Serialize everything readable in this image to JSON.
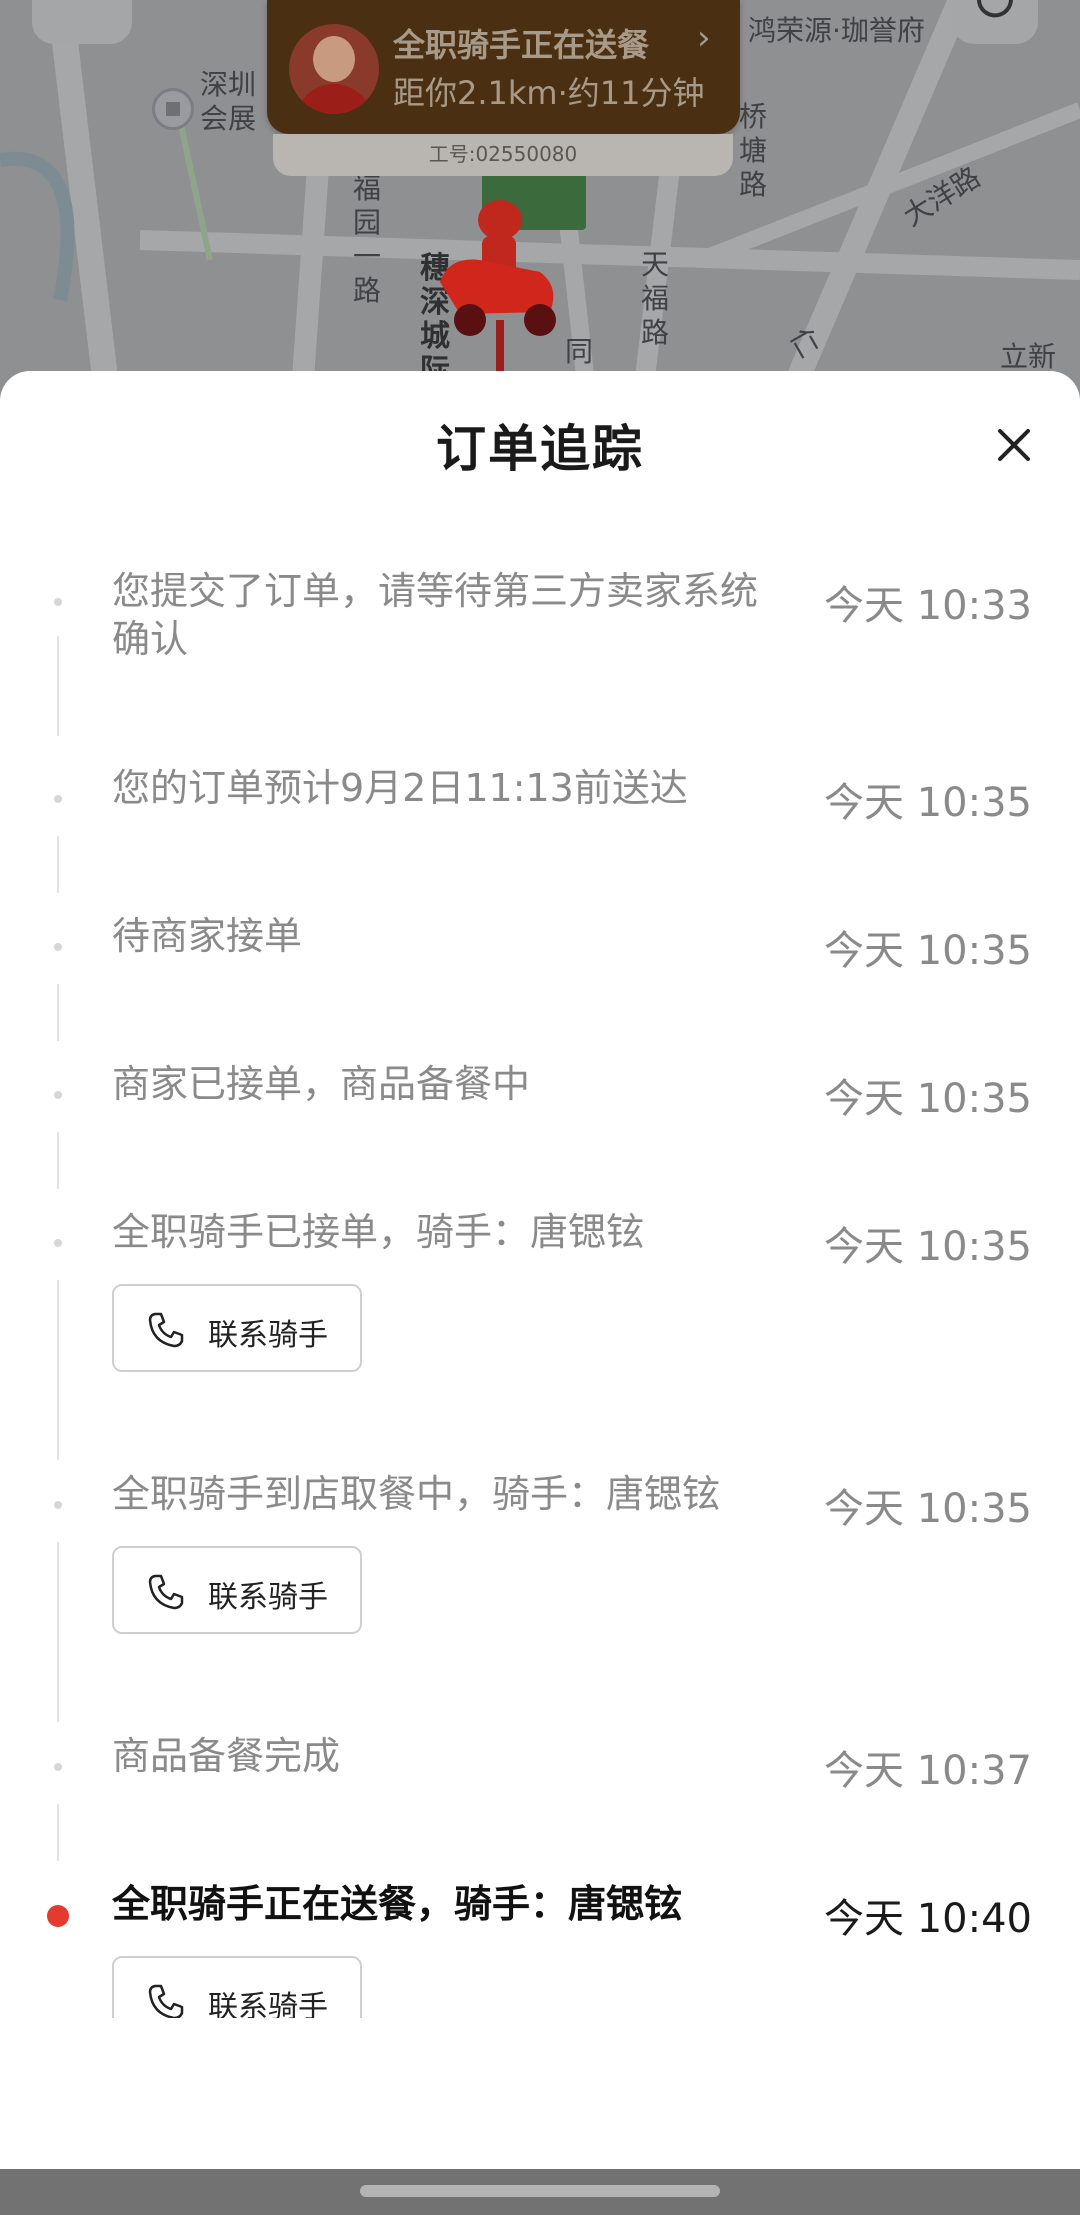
{
  "map": {
    "labels": {
      "shenzhen_hall": "深圳会展",
      "futian_rd": "福园一路",
      "suishenzheng": "穗深城际",
      "tong": "同",
      "qiaotang": "桥塘路",
      "tianfu": "天福路",
      "dayang": "大洋路",
      "hongrong": "鸿荣源·珈誉府",
      "lixin": "立新",
      "ren": "仁"
    },
    "rider_card": {
      "title": "全职骑手正在送餐",
      "subtitle": "距你2.1km·约11分钟",
      "work_id": "工号:02550080"
    }
  },
  "sheet": {
    "title": "订单追踪",
    "events": [
      {
        "text": "您提交了订单，请等待第三方卖家系统确认",
        "time": "今天 10:33",
        "active": false
      },
      {
        "text": "您的订单预计9月2日11:13前送达",
        "time": "今天 10:35",
        "active": false
      },
      {
        "text": "待商家接单",
        "time": "今天 10:35",
        "active": false
      },
      {
        "text": "商家已接单，商品备餐中",
        "time": "今天 10:35",
        "active": false
      },
      {
        "text": "全职骑手已接单，骑手：唐锶铉",
        "time": "今天 10:35",
        "active": false,
        "button": "联系骑手"
      },
      {
        "text": "全职骑手到店取餐中，骑手：唐锶铉",
        "time": "今天 10:35",
        "active": false,
        "button": "联系骑手"
      },
      {
        "text": "商品备餐完成",
        "time": "今天 10:37",
        "active": false
      },
      {
        "text": "全职骑手正在送餐，骑手：唐锶铉",
        "time": "今天 10:40",
        "active": true,
        "button": "联系骑手"
      }
    ]
  },
  "icons": {
    "back": "chevron-left-icon",
    "refresh": "refresh-icon",
    "close": "close-icon",
    "phone": "phone-icon",
    "chevron": "chevron-right-icon"
  },
  "colors": {
    "active_dot": "#e53a30",
    "inactive_text": "#8a8a8a",
    "active_text": "#111111"
  }
}
